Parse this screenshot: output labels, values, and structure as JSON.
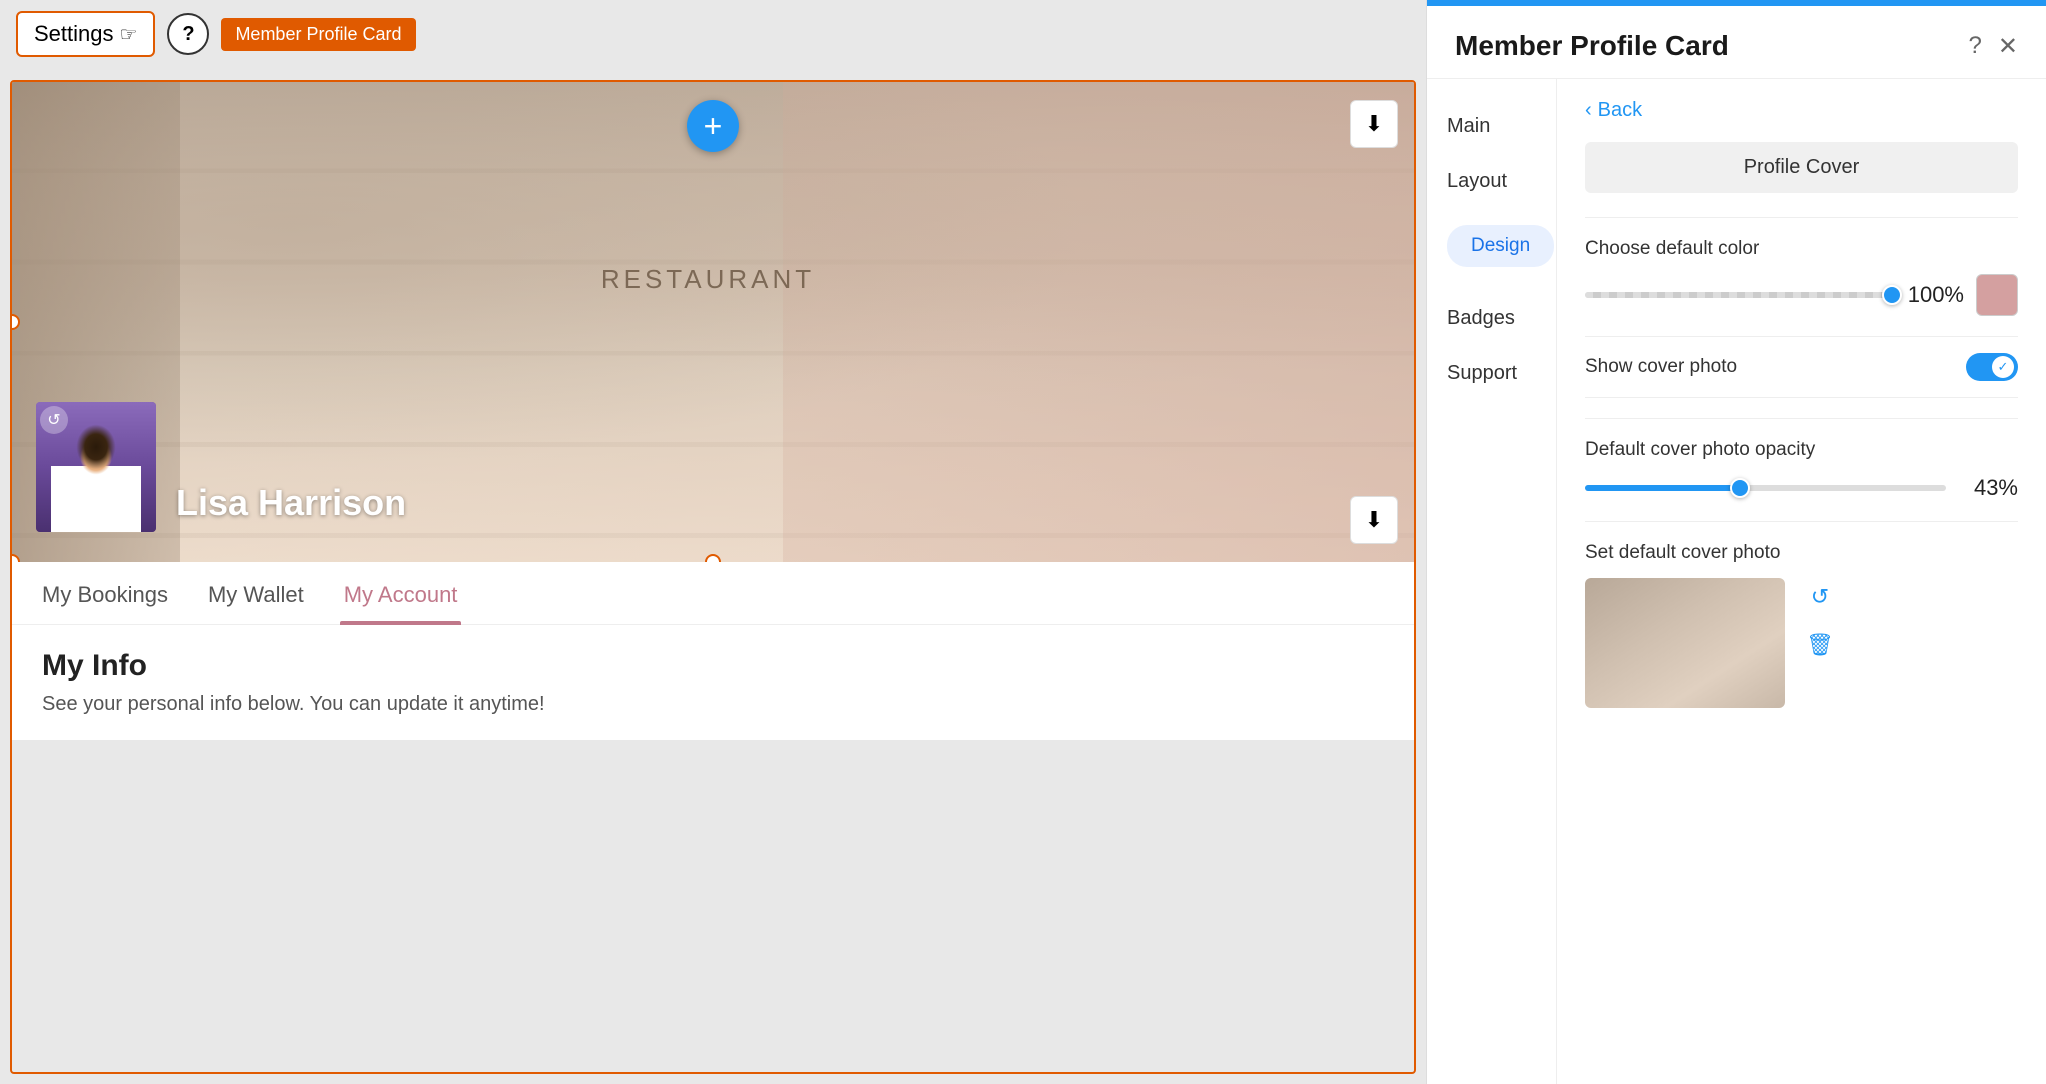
{
  "toolbar": {
    "settings_label": "Settings",
    "help_label": "?",
    "badge_label": "Member Profile Card"
  },
  "canvas": {
    "cover_photo": {
      "restaurant_sign": "RESTAURANT",
      "user_name": "Lisa Harrison"
    },
    "tabs": [
      {
        "label": "My Bookings",
        "active": false
      },
      {
        "label": "My Wallet",
        "active": false
      },
      {
        "label": "My Account",
        "active": true
      }
    ],
    "my_info": {
      "title": "My Info",
      "subtitle": "See your personal info below. You can update it anytime!"
    }
  },
  "panel": {
    "title": "Member Profile Card",
    "help_icon": "?",
    "close_icon": "✕",
    "nav_items": [
      {
        "label": "Main"
      },
      {
        "label": "Layout"
      },
      {
        "label": "Design"
      },
      {
        "label": "Badges"
      },
      {
        "label": "Support"
      }
    ],
    "back_label": "Back",
    "section_heading": "Profile Cover",
    "design_tab_label": "Design",
    "color_section": {
      "label": "Choose default color",
      "percent": "100%",
      "slider_value": 100
    },
    "show_cover": {
      "label": "Show cover photo",
      "enabled": true
    },
    "opacity_section": {
      "label": "Default cover photo opacity",
      "percent": "43%",
      "value": 43
    },
    "cover_photo_section": {
      "label": "Set default cover photo",
      "refresh_icon": "↺",
      "delete_icon": "🗑"
    }
  }
}
